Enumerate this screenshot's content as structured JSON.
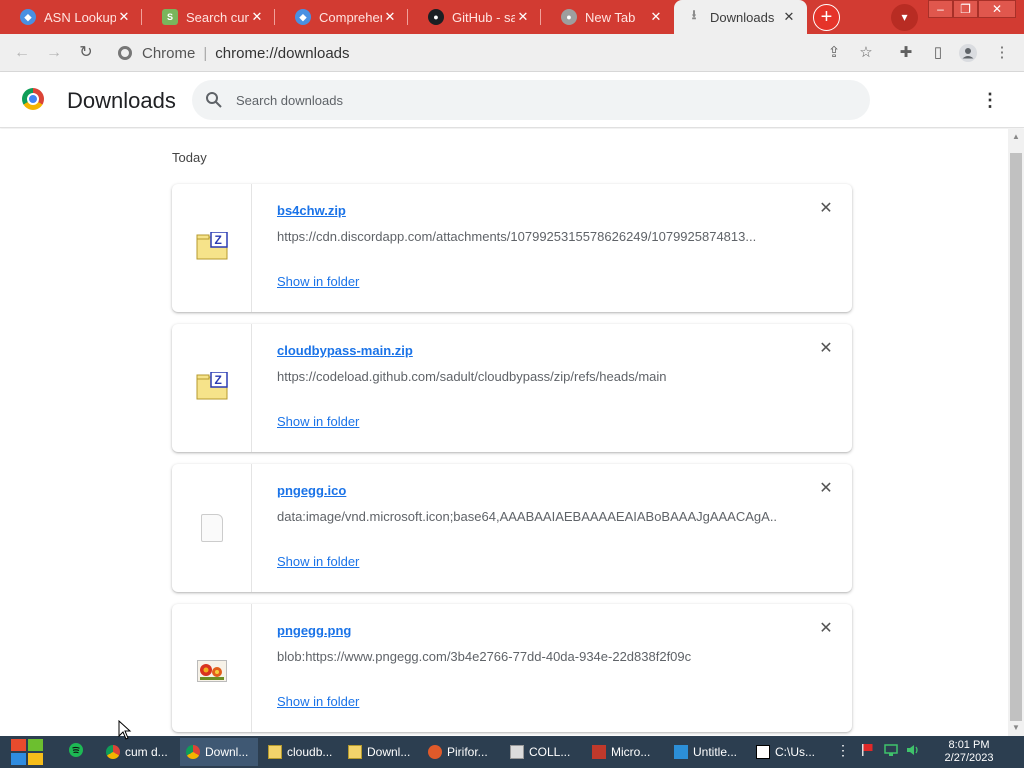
{
  "tabs": [
    {
      "label": "ASN Lookup",
      "icon": "shield-icon"
    },
    {
      "label": "Search cum",
      "icon": "shopify-icon"
    },
    {
      "label": "Comprehen",
      "icon": "shield-icon"
    },
    {
      "label": "GitHub - sa",
      "icon": "github-icon"
    },
    {
      "label": "New Tab",
      "icon": "chrome-icon"
    },
    {
      "label": "Downloads",
      "icon": "download-icon"
    }
  ],
  "omnibox": {
    "site": "Chrome",
    "divider": "|",
    "url": "chrome://downloads"
  },
  "downloads": {
    "title": "Downloads",
    "search_placeholder": "Search downloads",
    "day_label": "Today",
    "items": [
      {
        "name": "bs4chw.zip",
        "url": "https://cdn.discordapp.com/attachments/1079925315578626249/1079925874813...",
        "action": "Show in folder",
        "icon": "zip-file-icon"
      },
      {
        "name": "cloudbypass-main.zip",
        "url": "https://codeload.github.com/sadult/cloudbypass/zip/refs/heads/main",
        "action": "Show in folder",
        "icon": "zip-file-icon"
      },
      {
        "name": "pngegg.ico",
        "url": "data:image/vnd.microsoft.icon;base64,AAABAAIAEBAAAAEAIABoBAAAJgAAACAgA...",
        "action": "Show in folder",
        "icon": "blank-file-icon"
      },
      {
        "name": "pngegg.png",
        "url": "blob:https://www.pngegg.com/3b4e2766-77dd-40da-934e-22d838f2f09c",
        "action": "Show in folder",
        "icon": "image-file-icon"
      }
    ]
  },
  "taskbar": {
    "items": [
      {
        "label": "cum d...",
        "icon": "chrome-icon"
      },
      {
        "label": "Downl...",
        "icon": "chrome-icon"
      },
      {
        "label": "cloudb...",
        "icon": "folder-icon"
      },
      {
        "label": "Downl...",
        "icon": "folder-icon"
      },
      {
        "label": "Pirifor...",
        "icon": "ccleaner-icon"
      },
      {
        "label": "COLL...",
        "icon": "app-icon"
      },
      {
        "label": "Micro...",
        "icon": "office-icon"
      },
      {
        "label": "Untitle...",
        "icon": "vscode-icon"
      },
      {
        "label": "C:\\Us...",
        "icon": "7zip-icon"
      }
    ],
    "clock_time": "8:01 PM",
    "clock_date": "2/27/2023"
  },
  "colors": {
    "tab_strip": "#d23b32",
    "link": "#1a73e8",
    "taskbar": "#2c3e50"
  }
}
